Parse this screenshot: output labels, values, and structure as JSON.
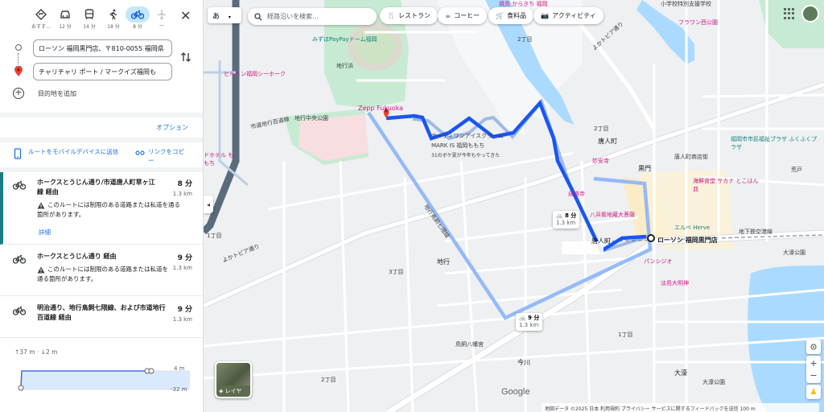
{
  "modes": [
    {
      "name": "best",
      "label": "おすす…"
    },
    {
      "name": "car",
      "label": "12 分"
    },
    {
      "name": "transit",
      "label": "14 分"
    },
    {
      "name": "walk",
      "label": "18 分"
    },
    {
      "name": "bike",
      "label": "8 分"
    },
    {
      "name": "flight",
      "label": "—"
    }
  ],
  "origin": "ローソン 福岡黒門店、〒810-0055 福岡県",
  "destination": "チャリチャリ ポート / マークイズ福岡も",
  "add_destination": "目的地を追加",
  "options_label": "オプション",
  "send_to_device": "ルートをモバイルデバイスに送信",
  "copy_link": "リンクをコピー",
  "routes": [
    {
      "title": "ホークスとうじん通り/市道唐人町草ヶ江線 経由",
      "time": "8 分",
      "distance": "1.3 km",
      "warning": "このルートには制限のある道路または私道を通る箇所があります。",
      "details": "詳細"
    },
    {
      "title": "ホークスとうじん通り 経由",
      "time": "9 分",
      "distance": "1.3 km",
      "warning": "このルートには制限のある道路または私道を通る箇所があります。"
    },
    {
      "title": "明治通り、地行鳥飼七隈線、および市道地行百道線 経由",
      "time": "9 分",
      "distance": "1.3 km"
    }
  ],
  "elevation": {
    "summary": "↑37 m · ↓2 m",
    "top": "4 m",
    "bottom": "-32 m"
  },
  "map": {
    "input_mode": "あ",
    "search_placeholder": "経路沿いを検索...",
    "chips": [
      "レストラン",
      "コーヒー",
      "食料品",
      "アクティビティ"
    ],
    "layer_label": "レイヤ",
    "route_box_1": {
      "time": "8 分",
      "dist": "1.3 km"
    },
    "route_box_2": {
      "time": "9 分",
      "dist": "1.3 km"
    },
    "origin_label": "ローソン 福岡黒門店",
    "labels": {
      "l1": "焼鳥 からきち 福岡",
      "l2": "小学校特別支援学校",
      "l3": "フラワン西公園",
      "l4": "みずほPayPayドーム福岡",
      "l5": "2丁目",
      "l6": "よかトピア通り",
      "l7": "地行浜",
      "l8": "ヒルトン福岡シーホーク",
      "l9": "Zepp Fukuoka",
      "l10": "地行中央公園",
      "l11": "市道地行百道線",
      "l12": "サーティワンアイスクリーム",
      "l13": "MARK IS 福岡ももち",
      "l14": "31のボケ夏が今年もやってきた",
      "l15": "2丁目",
      "l16": "唐人町",
      "l17": "福岡市市民福祉プラザ ふくふくプラザ",
      "l18": "妙安寺",
      "l19": "唐人町商店街",
      "l20": "黒門",
      "l21": "荒戸",
      "l22": "海鮮食堂 サカナ とこはん 皿",
      "l23": "成道寺",
      "l24": "八兵衛地蔵大菩薩",
      "l25": "エルベ Herve",
      "l26": "唐人町",
      "l27": "地下鉄空港線",
      "l28": "大濠公園",
      "l29": "パンシジオ",
      "l30": "淡島大明神",
      "l31": "ドホテル ももち",
      "l32": "地行鳥飼七隈線",
      "l33": "地行",
      "l34": "3丁目",
      "l35": "1丁目",
      "l36": "鳥飼八幡宮",
      "l37": "今川",
      "l38": "2丁目",
      "l39": "よかトピア通り",
      "l40": "大濠",
      "l41": "大濠公園",
      "l42": "1丁目"
    },
    "google": "Google",
    "footer": "地図データ ©2025  日本  利用規約  プライバシー  サービスに関するフィードバックを送信  100 m"
  }
}
